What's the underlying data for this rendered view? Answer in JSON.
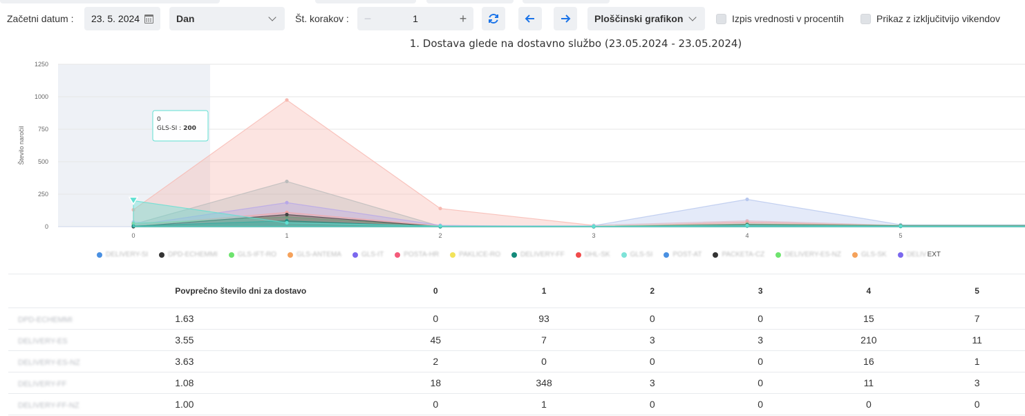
{
  "toolbar": {
    "start_date_label": "Začetni datum :",
    "start_date_value": "23. 5. 2024",
    "period_value": "Dan",
    "steps_label": "Št. korakov :",
    "steps_value": "1",
    "minus": "−",
    "plus": "+",
    "refresh_icon": "refresh-icon",
    "prev_icon": "arrow-left-icon",
    "next_icon": "arrow-right-icon",
    "chart_type_value": "Ploščinski grafikon",
    "percent_label": "Izpis vrednosti v procentih",
    "weekend_label": "Prikaz z izključitvijo vikendov",
    "accent_color": "#1a73e8"
  },
  "chart_title": "1. Dostava glede na dostavno službo (23.05.2024 - 23.05.2024)",
  "tooltip": {
    "x": "0",
    "series": "GLS-SI :",
    "value": "200"
  },
  "legend": [
    {
      "name": "DELIVERY-SI",
      "color": "#4a90e2"
    },
    {
      "name": "DPD-ECHEMMI",
      "color": "#333333"
    },
    {
      "name": "GLS-IFT-RO",
      "color": "#6ee36e"
    },
    {
      "name": "GLS-ANTEMA",
      "color": "#f5a25b"
    },
    {
      "name": "GLS-IT",
      "color": "#7b68ee"
    },
    {
      "name": "POSTA-HR",
      "color": "#f45b7a"
    },
    {
      "name": "PAKLICE-RO",
      "color": "#f2e35a"
    },
    {
      "name": "DELIVERY-FF",
      "color": "#138a7a"
    },
    {
      "name": "DHL-SK",
      "color": "#f04b4b"
    },
    {
      "name": "GLS-SI",
      "color": "#7ee3d8"
    },
    {
      "name": "POST-AT",
      "color": "#4a90e2"
    },
    {
      "name": "PACKETA-CZ",
      "color": "#333333"
    },
    {
      "name": "DELIVERY-ES-NZ",
      "color": "#6ee36e"
    },
    {
      "name": "GLS-SK",
      "color": "#f5a25b"
    },
    {
      "name": "DELIVEXT",
      "color": "#7b68ee",
      "visible_suffix": "EXT"
    }
  ],
  "chart_data": {
    "type": "area",
    "title": "1. Dostava glede na dostavno službo (23.05.2024 - 23.05.2024)",
    "xlabel": "",
    "ylabel": "Število naročil",
    "x": [
      "0",
      "1",
      "2",
      "3",
      "4",
      "5"
    ],
    "ylim": [
      0,
      1250
    ],
    "yticks": [
      0,
      250,
      500,
      750,
      1000,
      1250
    ],
    "grid": true,
    "legend_position": "bottom",
    "highlighted_x": "0",
    "series": [
      {
        "name": "",
        "color": "#f7b8b0",
        "values": [
          130,
          975,
          140,
          10,
          45,
          10
        ]
      },
      {
        "name": "",
        "color": "#bbbbbb",
        "values": [
          18,
          348,
          3,
          0,
          11,
          3
        ]
      },
      {
        "name": "",
        "color": "#b7c7ee",
        "values": [
          35,
          10,
          5,
          8,
          210,
          15
        ]
      },
      {
        "name": "",
        "color": "#b8a8e8",
        "values": [
          10,
          185,
          10,
          0,
          20,
          5
        ]
      },
      {
        "name": "",
        "color": "#f0a6a6",
        "values": [
          8,
          110,
          5,
          0,
          35,
          5
        ]
      },
      {
        "name": "",
        "color": "#8fd39a",
        "values": [
          25,
          75,
          3,
          3,
          20,
          10
        ]
      },
      {
        "name": "",
        "color": "#444444",
        "values": [
          0,
          93,
          0,
          0,
          15,
          7
        ]
      },
      {
        "name": "",
        "color": "#1d8f83",
        "values": [
          5,
          45,
          0,
          0,
          5,
          2
        ]
      },
      {
        "name": "GLS-SI",
        "color": "#5fe0d2",
        "values": [
          200,
          30,
          5,
          2,
          10,
          5
        ]
      }
    ]
  },
  "table": {
    "headers": [
      "",
      "Povprečno število dni za dostavo",
      "0",
      "1",
      "2",
      "3",
      "4",
      "5"
    ],
    "rows": [
      {
        "name": "DPD-ECHEMMI",
        "avg": "1.63",
        "vals": [
          "0",
          "93",
          "0",
          "0",
          "15",
          "7"
        ]
      },
      {
        "name": "DELIVERY-ES",
        "avg": "3.55",
        "vals": [
          "45",
          "7",
          "3",
          "3",
          "210",
          "11"
        ]
      },
      {
        "name": "DELIVERY-ES-NZ",
        "avg": "3.63",
        "vals": [
          "2",
          "0",
          "0",
          "0",
          "16",
          "1"
        ]
      },
      {
        "name": "DELIVERY-FF",
        "avg": "1.08",
        "vals": [
          "18",
          "348",
          "3",
          "0",
          "11",
          "3"
        ]
      },
      {
        "name": "DELIVERY-FF-NZ",
        "avg": "1.00",
        "vals": [
          "0",
          "1",
          "0",
          "0",
          "0",
          "0"
        ]
      }
    ]
  }
}
